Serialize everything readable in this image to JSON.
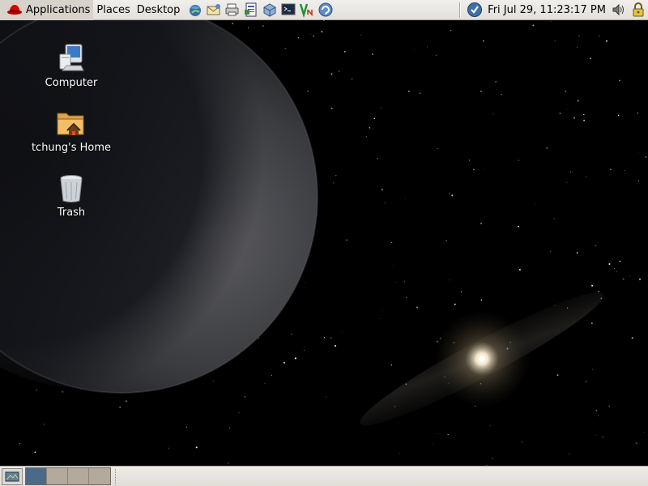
{
  "top_panel": {
    "menus": {
      "applications": "Applications",
      "places": "Places",
      "desktop": "Desktop"
    },
    "launchers": [
      {
        "name": "web-browser-icon"
      },
      {
        "name": "email-client-icon"
      },
      {
        "name": "printer-icon"
      },
      {
        "name": "office-writer-icon"
      },
      {
        "name": "package-icon"
      },
      {
        "name": "terminal-icon"
      },
      {
        "name": "vnc-viewer-icon"
      },
      {
        "name": "update-icon"
      }
    ],
    "clock": "Fri Jul 29, 11:23:17 PM"
  },
  "desktop_icons": [
    {
      "label": "Computer",
      "icon": "computer-icon"
    },
    {
      "label": "tchung's Home",
      "icon": "home-folder-icon"
    },
    {
      "label": "Trash",
      "icon": "trash-icon"
    }
  ],
  "bottom_panel": {
    "workspaces_count": 4,
    "active_workspace": 1
  },
  "colors": {
    "panel_bg": "#e6e3de",
    "active_workspace": "#4b6a88",
    "inactive_workspace": "#b4a99d"
  }
}
